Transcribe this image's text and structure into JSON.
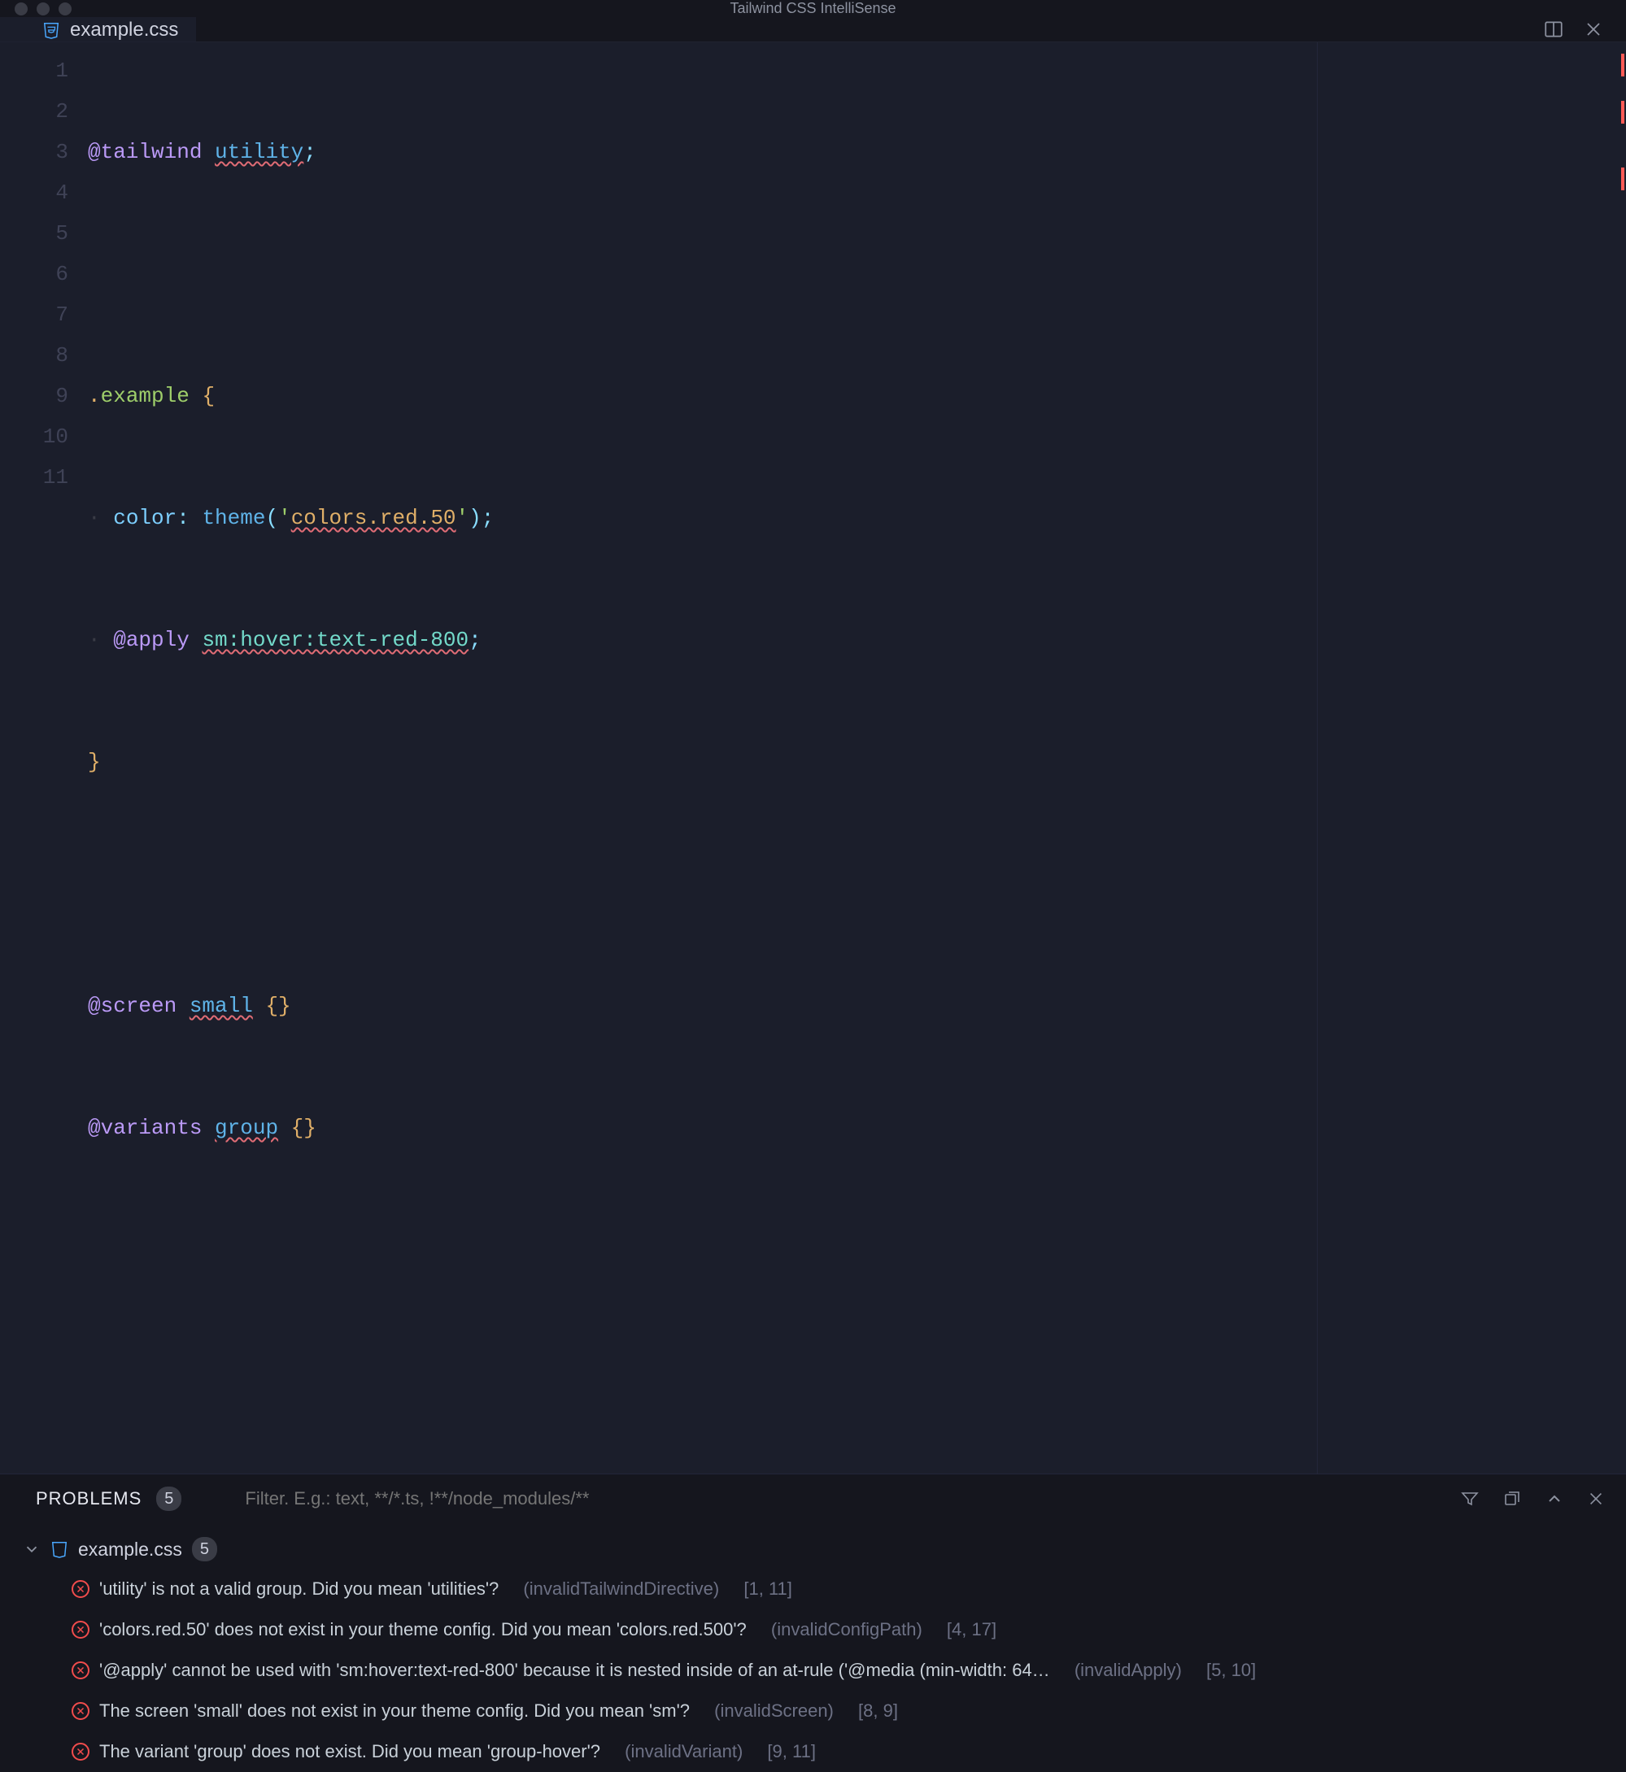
{
  "window": {
    "title": "Tailwind CSS IntelliSense",
    "filename": "example.css"
  },
  "editor": {
    "line_numbers": [
      "1",
      "2",
      "3",
      "4",
      "5",
      "6",
      "7",
      "8",
      "9",
      "10",
      "11"
    ]
  },
  "code": {
    "l1_at": "@tailwind",
    "l1_val": "utility",
    "l1_semi": ";",
    "l3_dot": ".",
    "l3_sel": "example",
    "l3_brace": "{",
    "l4_prop": "color",
    "l4_colon": ": ",
    "l4_fn": "theme",
    "l4_paren_o": "(",
    "l4_q1": "'",
    "l4_str": "colors.red.50",
    "l4_q2": "'",
    "l4_paren_c": ")",
    "l4_semi": ";",
    "l5_at": "@apply",
    "l5_cls": "sm:hover:text-red-800",
    "l5_semi": ";",
    "l6_brace": "}",
    "l8_at": "@screen",
    "l8_name": "small",
    "l8_braces": "{}",
    "l9_at": "@variants",
    "l9_name": "group",
    "l9_braces": "{}"
  },
  "panel": {
    "title": "PROBLEMS",
    "count": "5",
    "filter_placeholder": "Filter. E.g.: text, **/*.ts, !**/node_modules/**",
    "file": "example.css",
    "file_count": "5"
  },
  "problems": [
    {
      "msg": "'utility' is not a valid group. Did you mean 'utilities'?",
      "code": "(invalidTailwindDirective)",
      "pos": "[1, 11]"
    },
    {
      "msg": "'colors.red.50' does not exist in your theme config. Did you mean 'colors.red.500'?",
      "code": "(invalidConfigPath)",
      "pos": "[4, 17]"
    },
    {
      "msg": "'@apply' cannot be used with 'sm:hover:text-red-800' because it is nested inside of an at-rule ('@media (min-width: 64…",
      "code": "(invalidApply)",
      "pos": "[5, 10]"
    },
    {
      "msg": "The screen 'small' does not exist in your theme config. Did you mean 'sm'?",
      "code": "(invalidScreen)",
      "pos": "[8, 9]"
    },
    {
      "msg": "The variant 'group' does not exist. Did you mean 'group-hover'?",
      "code": "(invalidVariant)",
      "pos": "[9, 11]"
    }
  ]
}
